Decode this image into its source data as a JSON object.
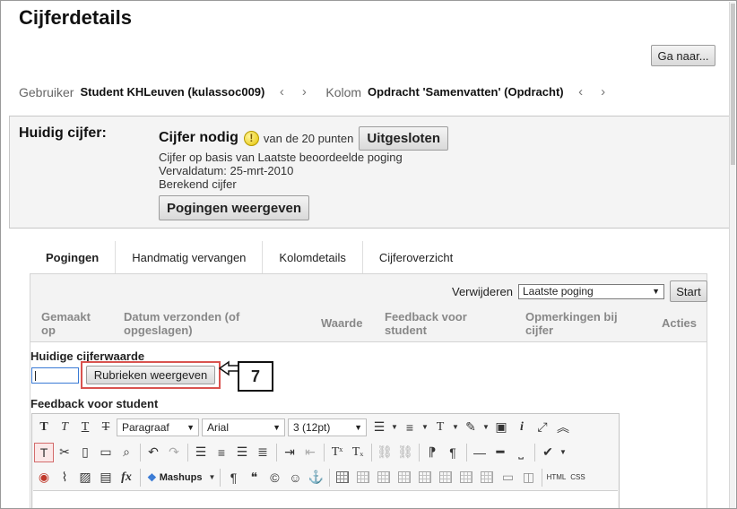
{
  "page": {
    "title": "Cijferdetails",
    "goto_label": "Ga naar..."
  },
  "nav": {
    "user_label": "Gebruiker",
    "user_value": "Student KHLeuven (kulassoc009)",
    "column_label": "Kolom",
    "column_value": "Opdracht 'Samenvatten' (Opdracht)",
    "prev": "‹",
    "next": "›"
  },
  "current_grade": {
    "label": "Huidig cijfer:",
    "status": "Cijfer nodig",
    "points_text": "van de 20 punten",
    "excluded_button": "Uitgesloten",
    "info_lines": [
      "Cijfer op basis van Laatste beoordeelde poging",
      "Vervaldatum: 25-mrt-2010",
      "Berekend cijfer"
    ],
    "show_attempts_button": "Pogingen weergeven"
  },
  "tabs": [
    {
      "label": "Pogingen",
      "active": true
    },
    {
      "label": "Handmatig vervangen",
      "active": false
    },
    {
      "label": "Kolomdetails",
      "active": false
    },
    {
      "label": "Cijferoverzicht",
      "active": false
    }
  ],
  "attempts": {
    "delete_label": "Verwijderen",
    "delete_option": "Laatste poging",
    "start_button": "Start",
    "columns": [
      {
        "line1": "Gemaakt",
        "line2": "op"
      },
      {
        "line1": "Datum verzonden (of",
        "line2": "opgeslagen)"
      },
      {
        "line1": "Waarde",
        "line2": ""
      },
      {
        "line1": "Feedback voor",
        "line2": "student"
      },
      {
        "line1": "Opmerkingen bij",
        "line2": "cijfer"
      },
      {
        "line1": "Acties",
        "line2": ""
      }
    ]
  },
  "grade_value": {
    "label": "Huidige cijferwaarde",
    "input_value": "",
    "rubric_button": "Rubrieken weergeven",
    "callout": "7"
  },
  "feedback": {
    "label": "Feedback voor student",
    "format_select": "Paragraaf",
    "font_select": "Arial",
    "size_select": "3 (12pt)",
    "mashups": "Mashups",
    "html_btn": "HTML",
    "css_btn": "CSS"
  },
  "colors": {
    "highlight": "#d9534f",
    "focus": "#3a7bd5",
    "panel_bg": "#f3f3f3"
  }
}
